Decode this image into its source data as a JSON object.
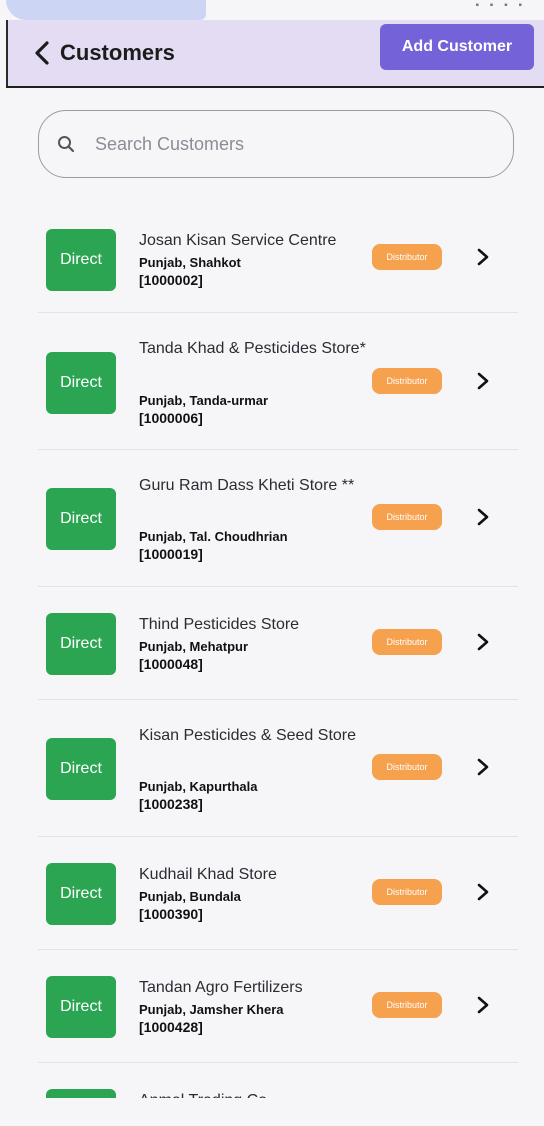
{
  "header": {
    "title": "Customers",
    "add_label": "Add Customer",
    "status_icons": "▪ ▪ ▪ ▪"
  },
  "search": {
    "placeholder": "Search Customers",
    "value": ""
  },
  "colors": {
    "accent": "#7462d8",
    "direct_badge": "#2ca553",
    "distributor_pill": "#f5a14d",
    "header_bg": "#e3dcf3"
  },
  "customers": [
    {
      "badge": "Direct",
      "name": "Josan Kisan Service Centre",
      "region": "Punjab, Shahkot",
      "code": "[1000002]",
      "type": "Distributor"
    },
    {
      "badge": "Direct",
      "name": "Tanda Khad & Pesticides Store*",
      "region": "Punjab, Tanda-urmar",
      "code": "[1000006]",
      "type": "Distributor"
    },
    {
      "badge": "Direct",
      "name": "Guru Ram Dass Kheti Store **",
      "region": "Punjab, Tal. Choudhrian",
      "code": "[1000019]",
      "type": "Distributor"
    },
    {
      "badge": "Direct",
      "name": "Thind Pesticides Store",
      "region": "Punjab, Mehatpur",
      "code": "[1000048]",
      "type": "Distributor"
    },
    {
      "badge": "Direct",
      "name": "Kisan Pesticides & Seed Store",
      "region": "Punjab, Kapurthala",
      "code": "[1000238]",
      "type": "Distributor"
    },
    {
      "badge": "Direct",
      "name": "Kudhail Khad Store",
      "region": "Punjab, Bundala",
      "code": "[1000390]",
      "type": "Distributor"
    },
    {
      "badge": "Direct",
      "name": "Tandan Agro Fertilizers",
      "region": "Punjab, Jamsher Khera",
      "code": "[1000428]",
      "type": "Distributor"
    },
    {
      "badge": "",
      "name": "Anmol Trading Co.",
      "region": "",
      "code": "",
      "type": ""
    }
  ]
}
